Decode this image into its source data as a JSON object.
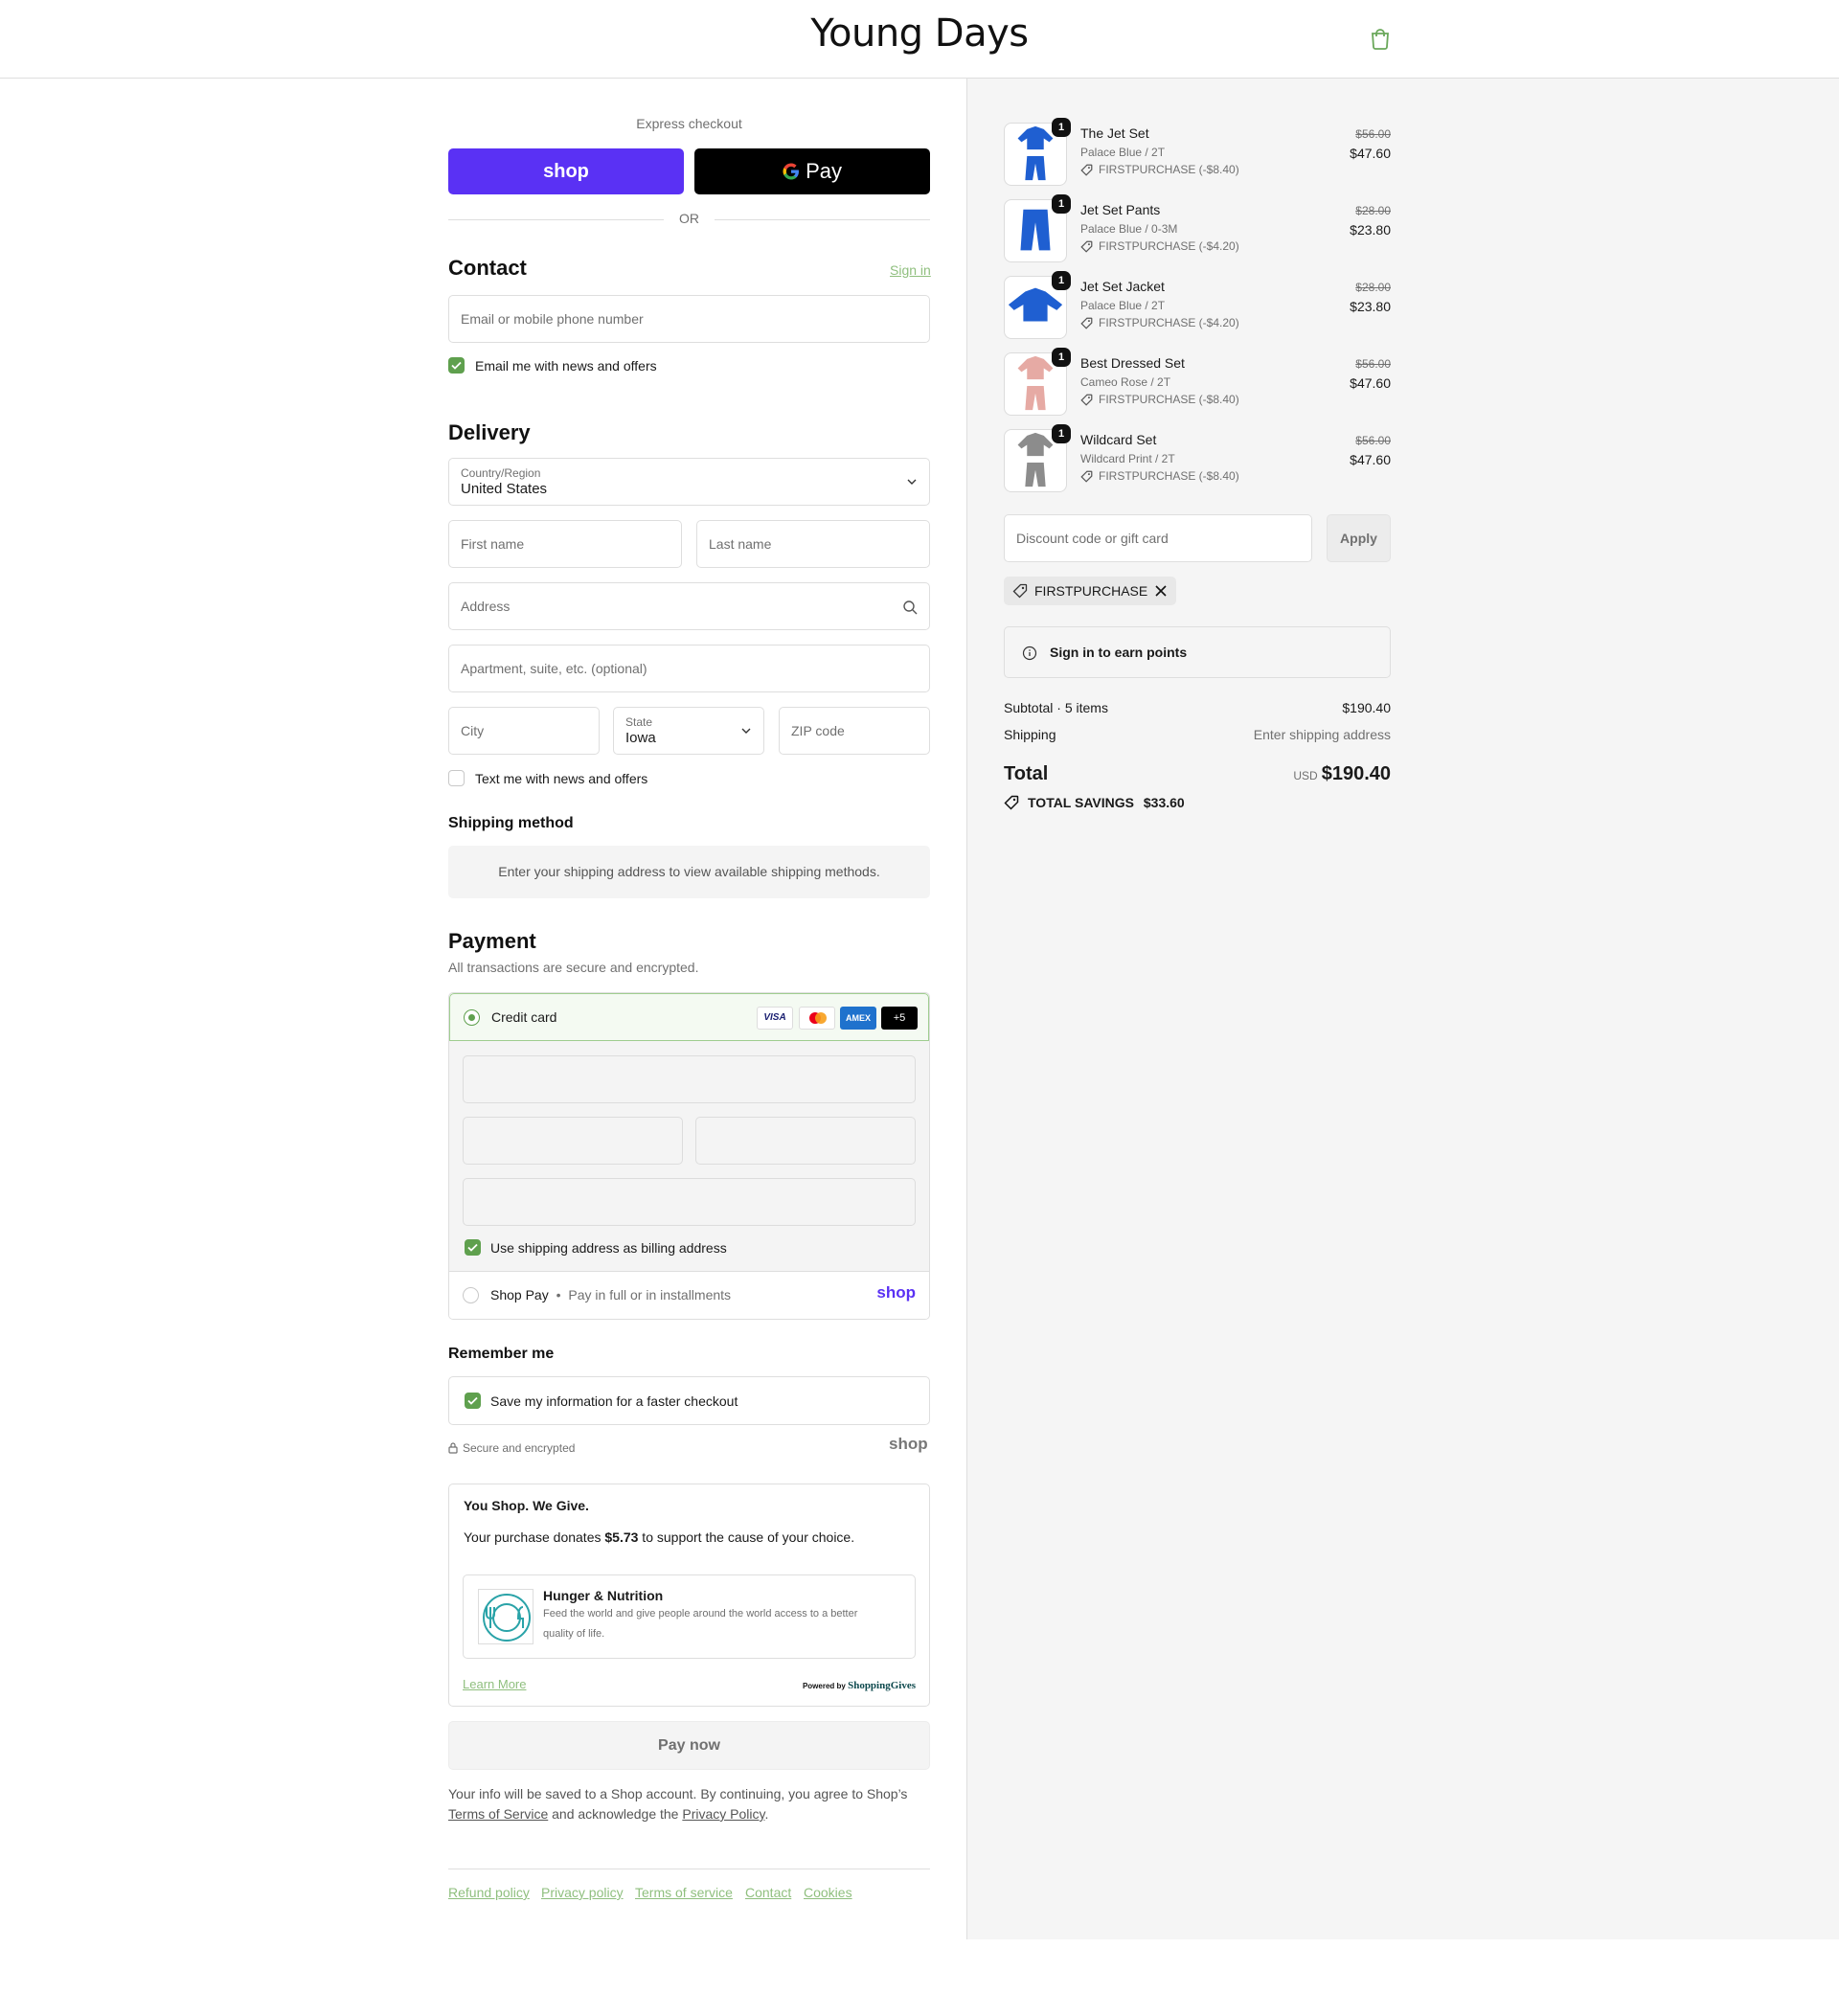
{
  "header": {
    "brand": "Young Days"
  },
  "express": {
    "title": "Express checkout",
    "shop_label": "shop",
    "gpay_label": "Pay",
    "or": "OR"
  },
  "contact": {
    "title": "Contact",
    "sign_in": "Sign in",
    "email_placeholder": "Email or mobile phone number",
    "newsletter_label": "Email me with news and offers"
  },
  "delivery": {
    "title": "Delivery",
    "country_label": "Country/Region",
    "country_value": "United States",
    "first_name_placeholder": "First name",
    "last_name_placeholder": "Last name",
    "address_placeholder": "Address",
    "apartment_placeholder": "Apartment, suite, etc. (optional)",
    "city_placeholder": "City",
    "state_label": "State",
    "state_value": "Iowa",
    "zip_placeholder": "ZIP code",
    "sms_label": "Text me with news and offers"
  },
  "shipping_method": {
    "title": "Shipping method",
    "message": "Enter your shipping address to view available shipping methods."
  },
  "payment": {
    "title": "Payment",
    "subtitle": "All transactions are secure and encrypted.",
    "credit_card_label": "Credit card",
    "card_logos": [
      "VISA",
      "",
      "AMEX",
      "+5"
    ],
    "billing_label": "Use shipping address as billing address",
    "shop_pay_label": "Shop Pay",
    "shop_pay_sep": "•",
    "shop_pay_desc": "Pay in full or in installments",
    "shop_pay_logo": "shop"
  },
  "remember": {
    "title": "Remember me",
    "save_label": "Save my information for a faster checkout",
    "secure_label": "Secure and encrypted",
    "shop_logo": "shop"
  },
  "giving": {
    "title": "You Shop. We Give.",
    "text_before": "Your purchase donates ",
    "amount": "$5.73",
    "text_after": " to support the cause of your choice.",
    "cause_title": "Hunger & Nutrition",
    "cause_desc_line1": "Feed the world and give people around the world access to a better",
    "cause_desc_line2": "quality of life.",
    "learn_more": "Learn More",
    "powered_by": "Powered by",
    "powered_brand": "ShoppingGives"
  },
  "pay_button": "Pay now",
  "legal": {
    "line1": "Your info will be saved to a Shop account. By continuing, you agree to Shop’s",
    "terms": "Terms of Service",
    "middle": " and acknowledge the ",
    "privacy": "Privacy Policy",
    "end": "."
  },
  "footer_links": [
    "Refund policy",
    "Privacy policy",
    "Terms of service",
    "Contact",
    "Cookies"
  ],
  "order": {
    "items": [
      {
        "qty": "1",
        "name": "The Jet Set",
        "variant": "Palace Blue / 2T",
        "discount": "FIRSTPURCHASE (-$8.40)",
        "original": "$56.00",
        "price": "$47.60",
        "color": "#1f5fd1",
        "kind": "set"
      },
      {
        "qty": "1",
        "name": "Jet Set Pants",
        "variant": "Palace Blue / 0-3M",
        "discount": "FIRSTPURCHASE (-$4.20)",
        "original": "$28.00",
        "price": "$23.80",
        "color": "#1f5fd1",
        "kind": "pants"
      },
      {
        "qty": "1",
        "name": "Jet Set Jacket",
        "variant": "Palace Blue / 2T",
        "discount": "FIRSTPURCHASE (-$4.20)",
        "original": "$28.00",
        "price": "$23.80",
        "color": "#1f5fd1",
        "kind": "jacket"
      },
      {
        "qty": "1",
        "name": "Best Dressed Set",
        "variant": "Cameo Rose / 2T",
        "discount": "FIRSTPURCHASE (-$8.40)",
        "original": "$56.00",
        "price": "$47.60",
        "color": "#e6aaa4",
        "kind": "set"
      },
      {
        "qty": "1",
        "name": "Wildcard Set",
        "variant": "Wildcard Print / 2T",
        "discount": "FIRSTPURCHASE (-$8.40)",
        "original": "$56.00",
        "price": "$47.60",
        "color": "#8c8c8c",
        "kind": "set"
      }
    ],
    "discount_placeholder": "Discount code or gift card",
    "apply": "Apply",
    "applied_code": "FIRSTPURCHASE",
    "points": "Sign in to earn points",
    "subtotal_label": "Subtotal · 5 items",
    "subtotal_value": "$190.40",
    "shipping_label": "Shipping",
    "shipping_value": "Enter shipping address",
    "total_label": "Total",
    "currency": "USD",
    "total_value": "$190.40",
    "savings_label": "TOTAL SAVINGS",
    "savings_value": "$33.60"
  },
  "colors": {
    "accent": "#5fa04e",
    "shop_purple": "#5a31f4",
    "link_green": "#8fbf7e"
  }
}
